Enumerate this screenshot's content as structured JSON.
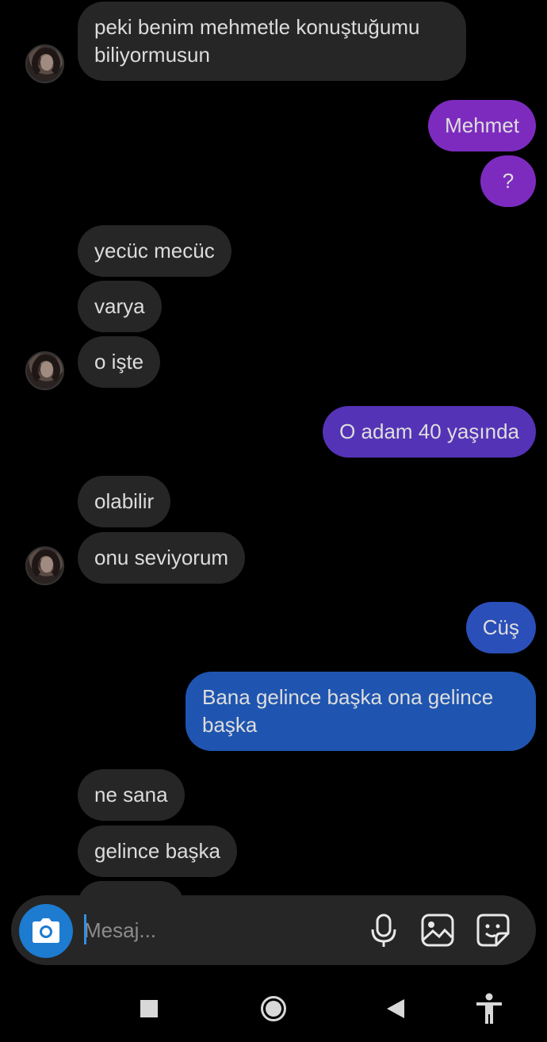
{
  "messages": [
    {
      "id": "m1",
      "side": "in",
      "text": "peki benim mehmetle konuştuğumu biliyormusun"
    },
    {
      "id": "m2",
      "side": "out",
      "text": "Mehmet",
      "color": "#7d2bbf"
    },
    {
      "id": "m3",
      "side": "out",
      "text": "?",
      "color": "#7d2bbf"
    },
    {
      "id": "m4",
      "side": "in",
      "text": "yecüc mecüc"
    },
    {
      "id": "m5",
      "side": "in",
      "text": "varya"
    },
    {
      "id": "m6",
      "side": "in",
      "text": "o işte"
    },
    {
      "id": "m7",
      "side": "out",
      "text": "O adam 40 yaşında",
      "color": "#5433b6"
    },
    {
      "id": "m8",
      "side": "in",
      "text": "olabilir"
    },
    {
      "id": "m9",
      "side": "in",
      "text": "onu seviyorum"
    },
    {
      "id": "m10",
      "side": "out",
      "text": "Cüş",
      "color": "#2b4fb8"
    },
    {
      "id": "m11",
      "side": "out",
      "text": "Bana gelince başka ona gelince başka",
      "color": "#1f55b0"
    },
    {
      "id": "m12",
      "side": "in",
      "text": "ne sana"
    },
    {
      "id": "m13",
      "side": "in",
      "text": "gelince başka"
    }
  ],
  "composer": {
    "placeholder": "Mesaj...",
    "icons": [
      "camera-icon",
      "microphone-icon",
      "gallery-icon",
      "sticker-icon"
    ],
    "camera_color": "#1d7bd0"
  },
  "navbar": {
    "icons": [
      "recents-square-icon",
      "home-circle-icon",
      "back-triangle-icon",
      "accessibility-icon"
    ]
  }
}
